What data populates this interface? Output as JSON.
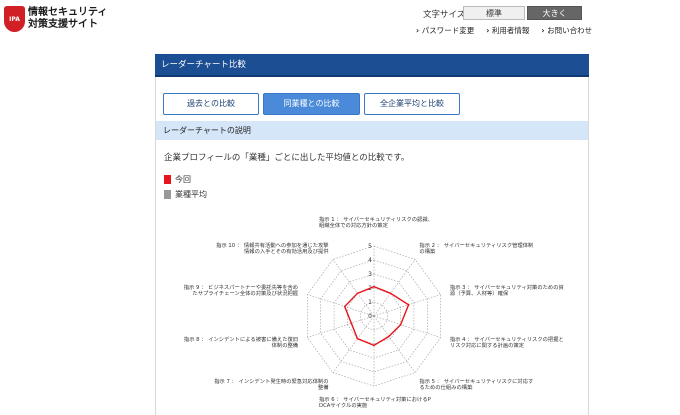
{
  "header": {
    "logo_badge": "IPA",
    "logo_line1": "情報セキュリティ",
    "logo_line2": "対策支援サイト",
    "font_size_label": "文字サイズ",
    "font_size_standard": "標準",
    "font_size_large": "大きく",
    "links": [
      {
        "label": "パスワード変更"
      },
      {
        "label": "利用者情報"
      },
      {
        "label": "お問い合わせ"
      }
    ]
  },
  "main": {
    "title": "レーダーチャート比較",
    "tabs": [
      {
        "label": "過去との比較",
        "active": false
      },
      {
        "label": "同業種との比較",
        "active": true
      },
      {
        "label": "全企業平均と比較",
        "active": false
      }
    ],
    "section_title": "レーダーチャートの説明",
    "description": "企業プロフィールの「業種」ごとに出した平均値との比較です。",
    "legend": [
      {
        "label": "今回",
        "color": "#e8141b"
      },
      {
        "label": "業種平均",
        "color": "#999999"
      }
    ]
  },
  "chart_data": {
    "type": "radar",
    "r_ticks": [
      "5",
      "4",
      "3",
      "2",
      "1",
      "0"
    ],
    "r_range": [
      0,
      5
    ],
    "axes": [
      [
        "指示 1 ： サイバーセキュリティリスクの認識、",
        "組織全体での対応方針の策定"
      ],
      [
        "指示 2 ： サイバーセキュリティリスク管理体制",
        "の構築"
      ],
      [
        "指示 3 ： サイバーセキュリティ対策のための資",
        "源（予算、人材等）確保"
      ],
      [
        "指示 4 ： サイバーセキュリティリスクの把握と",
        "リスク対応に関する計画の策定"
      ],
      [
        "指示 5 ： サイバーセキュリティリスクに対応す",
        "るための仕組みの構築"
      ],
      [
        "指示 6 ： サイバーセキュリティ対策におけるP",
        "DCAサイクルの実施"
      ],
      [
        "指示 7 ： インシデント発生時の緊急対応体制の",
        "整備"
      ],
      [
        "指示 8 ： インシデントによる被害に備えた復旧",
        "体制の整備"
      ],
      [
        "指示 9 ： ビジネスパートナーや委託先等を含め",
        "たサプライチェーン全体の対策及び状況把握"
      ],
      [
        "指示 10 ： 情報共有活動への参加を通じた攻撃",
        "情報の入手とその有効活用及び提供"
      ]
    ],
    "series": [
      {
        "name": "今回",
        "color": "#e8141b",
        "values": [
          2.1,
          2.0,
          2.6,
          2.0,
          1.8,
          2.1,
          2.0,
          1.7,
          2.2,
          2.0
        ]
      }
    ]
  }
}
